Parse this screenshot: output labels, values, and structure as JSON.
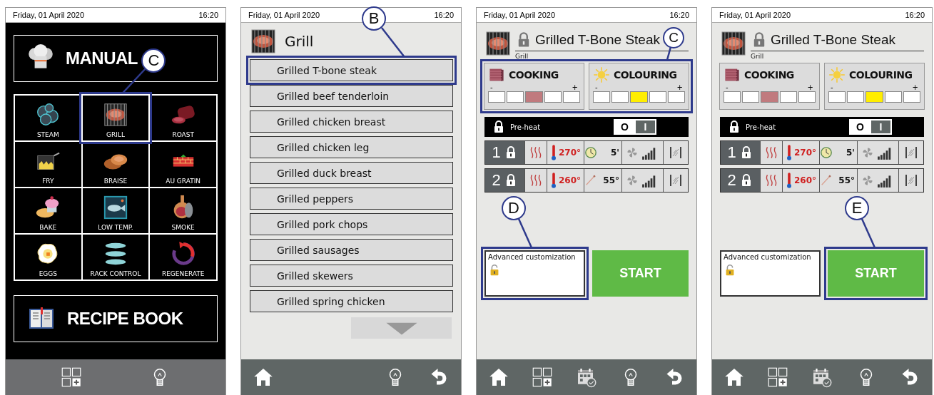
{
  "screens": [
    {
      "kind": "menu",
      "status": {
        "date": "Friday, 01 April 2020",
        "time": "16:20"
      },
      "manual": {
        "label": "MANUAL"
      },
      "tiles": [
        {
          "kind": "steam",
          "label": "STEAM"
        },
        {
          "kind": "grill",
          "label": "GRILL",
          "callout": "C"
        },
        {
          "kind": "roast",
          "label": "ROAST"
        },
        {
          "kind": "fry",
          "label": "FRY"
        },
        {
          "kind": "braise",
          "label": "BRAISE"
        },
        {
          "kind": "gratin",
          "label": "AU GRATIN"
        },
        {
          "kind": "bake",
          "label": "BAKE"
        },
        {
          "kind": "lowtemp",
          "label": "LOW TEMP."
        },
        {
          "kind": "smoke",
          "label": "SMOKE"
        },
        {
          "kind": "eggs",
          "label": "EGGS"
        },
        {
          "kind": "rack",
          "label": "RACK CONTROL"
        },
        {
          "kind": "regen",
          "label": "REGENERATE"
        }
      ],
      "recipe_book": {
        "label": "RECIPE BOOK"
      },
      "nav": [
        {
          "kind": "grid"
        },
        {
          "kind": "tip"
        }
      ]
    },
    {
      "kind": "list",
      "status": {
        "date": "Friday, 01 April 2020",
        "time": "16:20"
      },
      "title": "Grill",
      "items": [
        {
          "label": "Grilled T-bone steak",
          "callout": "B"
        },
        {
          "label": "Grilled beef tenderloin"
        },
        {
          "label": "Grilled chicken breast"
        },
        {
          "label": "Grilled chicken leg"
        },
        {
          "label": "Grilled duck breast"
        },
        {
          "label": "Grilled peppers"
        },
        {
          "label": "Grilled pork chops"
        },
        {
          "label": "Grilled sausages"
        },
        {
          "label": "Grilled skewers"
        },
        {
          "label": "Grilled spring chicken"
        }
      ],
      "nav": [
        {
          "kind": "home"
        },
        {
          "kind": "tip"
        },
        {
          "kind": "back"
        }
      ]
    },
    {
      "kind": "recipe",
      "status": {
        "date": "Friday, 01 April 2020",
        "time": "16:20"
      },
      "title": "Grilled T-Bone Steak",
      "category": "Grill",
      "settings_callout": "C",
      "settings": [
        {
          "kind": "cooking",
          "label": "COOKING",
          "minus": "-",
          "plus": "+",
          "color": "#c07a7e",
          "segments": [
            {
              "selected": false
            },
            {
              "selected": false
            },
            {
              "selected": true
            },
            {
              "selected": false
            },
            {
              "selected": false
            }
          ]
        },
        {
          "kind": "colouring",
          "label": "COLOURING",
          "minus": "-",
          "plus": "+",
          "color": "#ffee00",
          "segments": [
            {
              "selected": false
            },
            {
              "selected": false
            },
            {
              "selected": true
            },
            {
              "selected": false
            },
            {
              "selected": false
            }
          ]
        }
      ],
      "preheat": {
        "label": "Pre-heat",
        "off_label": "O",
        "on_label": "I",
        "on": false
      },
      "phases": [
        {
          "number": "1",
          "temperature": "270°",
          "kind": "timer",
          "value": "5'"
        },
        {
          "number": "2",
          "temperature": "260°",
          "kind": "probe",
          "value": "55°"
        }
      ],
      "advanced": {
        "label": "Advanced customization",
        "callout": "D"
      },
      "start": {
        "label": "START"
      },
      "nav": [
        {
          "kind": "home"
        },
        {
          "kind": "grid"
        },
        {
          "kind": "calendar"
        },
        {
          "kind": "tip"
        },
        {
          "kind": "back"
        }
      ]
    },
    {
      "kind": "recipe",
      "status": {
        "date": "Friday, 01 April 2020",
        "time": "16:20"
      },
      "title": "Grilled T-Bone Steak",
      "category": "Grill",
      "settings": [
        {
          "kind": "cooking",
          "label": "COOKING",
          "minus": "-",
          "plus": "+",
          "color": "#c07a7e",
          "segments": [
            {
              "selected": false
            },
            {
              "selected": false
            },
            {
              "selected": true
            },
            {
              "selected": false
            },
            {
              "selected": false
            }
          ]
        },
        {
          "kind": "colouring",
          "label": "COLOURING",
          "minus": "-",
          "plus": "+",
          "color": "#ffee00",
          "segments": [
            {
              "selected": false
            },
            {
              "selected": false
            },
            {
              "selected": true
            },
            {
              "selected": false
            },
            {
              "selected": false
            }
          ]
        }
      ],
      "preheat": {
        "label": "Pre-heat",
        "off_label": "O",
        "on_label": "I",
        "on": false
      },
      "phases": [
        {
          "number": "1",
          "temperature": "270°",
          "kind": "timer",
          "value": "5'"
        },
        {
          "number": "2",
          "temperature": "260°",
          "kind": "probe",
          "value": "55°"
        }
      ],
      "advanced": {
        "label": "Advanced customization"
      },
      "start": {
        "label": "START",
        "callout": "E"
      },
      "nav": [
        {
          "kind": "home"
        },
        {
          "kind": "grid"
        },
        {
          "kind": "calendar"
        },
        {
          "kind": "tip"
        },
        {
          "kind": "back"
        }
      ]
    }
  ]
}
